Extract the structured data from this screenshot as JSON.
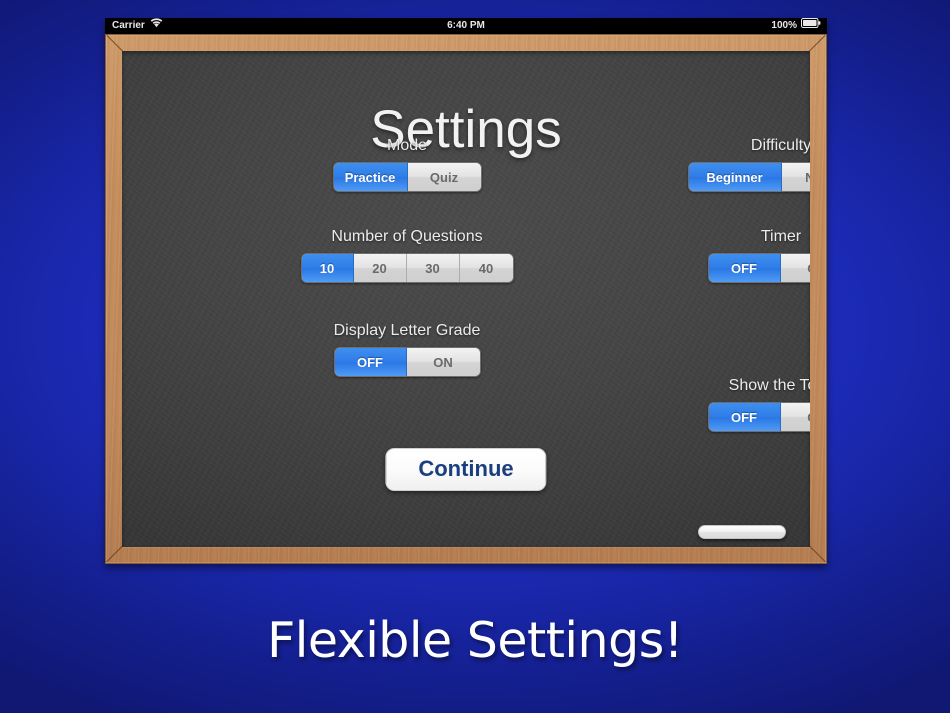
{
  "statusbar": {
    "carrier": "Carrier",
    "wifi_icon": "wifi-icon",
    "time": "6:40 PM",
    "battery_percent": "100%",
    "battery_icon": "battery-full-icon"
  },
  "screen": {
    "title": "Settings",
    "continue_label": "Continue",
    "chalk_icon": "chalk-eraser"
  },
  "settings": {
    "mode": {
      "label": "Mode",
      "options": [
        "Practice",
        "Quiz"
      ],
      "selected": 0
    },
    "difficulty": {
      "label": "Difficulty",
      "options": [
        "Beginner",
        "Normal"
      ],
      "selected": 0
    },
    "number_of_questions": {
      "label": "Number of Questions",
      "options": [
        "10",
        "20",
        "30",
        "40"
      ],
      "selected": 0
    },
    "timer": {
      "label": "Timer",
      "options": [
        "OFF",
        "ON"
      ],
      "selected": 0
    },
    "display_letter_grade": {
      "label": "Display Letter Grade",
      "options": [
        "OFF",
        "ON"
      ],
      "selected": 0
    },
    "show_the_total": {
      "label": "Show the Total",
      "options": [
        "OFF",
        "ON"
      ],
      "selected": 0
    }
  },
  "caption": "Flexible Settings!",
  "colors": {
    "background_center": "#2236d8",
    "background_edge": "#101874",
    "wood_frame": "#c2895a",
    "chalkboard": "#434343",
    "segment_selected": "#2f7de8",
    "segment_unselected": "#e3e3e3",
    "continue_text": "#1b3f7e"
  }
}
